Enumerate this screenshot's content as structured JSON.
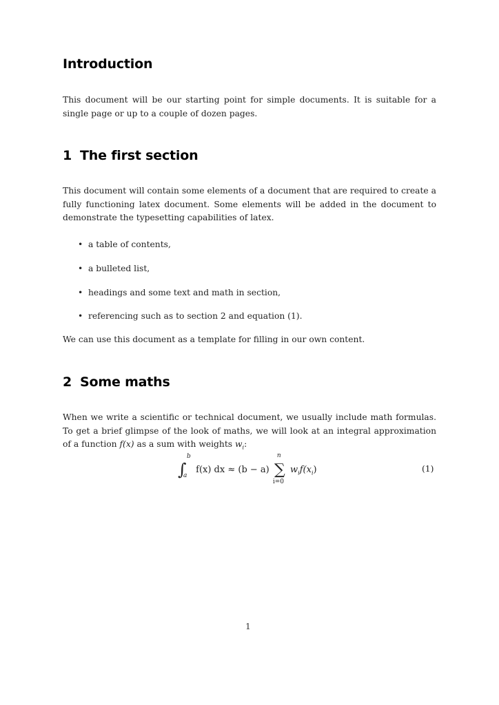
{
  "intro": {
    "heading": "Introduction",
    "paragraph": "This document will be our starting point for simple documents. It is suitable for a single page or up to a couple of dozen pages."
  },
  "section1": {
    "number": "1",
    "title": "The first section",
    "paragraph": "This document will contain some elements of a document that are required to create a fully functioning latex document. Some elements will be added in the document to demonstrate the typesetting capabilities of latex.",
    "bullets": [
      "a table of contents,",
      "a bulleted list,",
      "headings and some text and math in section,",
      "referencing such as to section 2 and equation (1)."
    ],
    "closing": "We can use this document as a template for filling in our own content."
  },
  "section2": {
    "number": "2",
    "title": "Some maths",
    "paragraph_pre": "When we write a scientific or technical document, we usually include math formulas. To get a brief glimpse of the look of maths, we will look at an integral approximation of a function ",
    "paragraph_fx": "f(x)",
    "paragraph_mid": " as a sum with weights ",
    "paragraph_w": "w",
    "paragraph_wsub": "i",
    "paragraph_end": ":",
    "equation": {
      "lower_limit": "a",
      "upper_limit": "b",
      "integrand": "f(x) dx ≈ (b − a)",
      "sum_upper": "n",
      "sum_lower": "i=0",
      "summand": "w",
      "summand_sub": "i",
      "summand_rest": "f(x",
      "summand_rest_sub": "i",
      "summand_close": ")",
      "label": "(1)"
    }
  },
  "footer": {
    "page_number": "1"
  }
}
